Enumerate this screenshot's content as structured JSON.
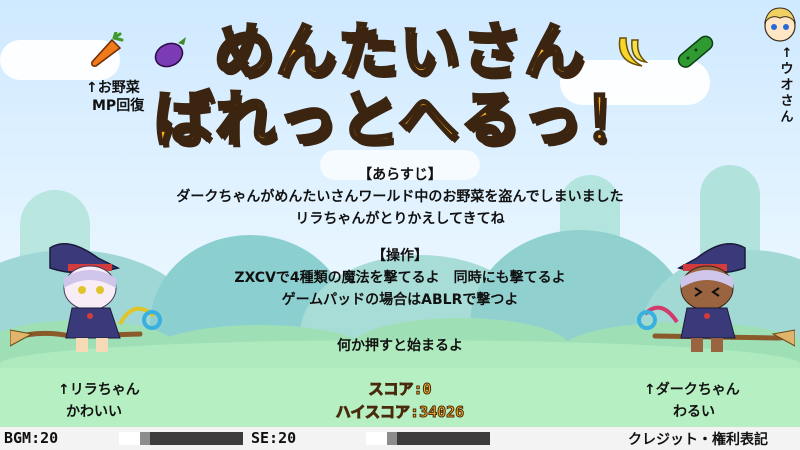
{
  "title": {
    "line1": "めんたいさん",
    "line2": "ばれっとへるっ！"
  },
  "veg_hint": {
    "line1": "↑お野菜",
    "line2": "MP回復"
  },
  "right_hint": "↑ウオさん",
  "story": {
    "heading": "【あらすじ】",
    "line1": "ダークちゃんがめんたいさんワールド中のお野菜を盗んでしまいました",
    "line2": "リラちゃんがとりかえしてきてね"
  },
  "controls": {
    "heading": "【操作】",
    "line1": "ZXCVで4種類の魔法を撃てるよ　同時にも撃てるよ",
    "line2": "ゲームパッドの場合はABLRで撃つよ"
  },
  "prompt": "何か押すと始まるよ",
  "score": {
    "score_line": "スコア:0",
    "hiscore_line": "ハイスコア:34026"
  },
  "left_char": {
    "line1": "↑リラちゃん",
    "line2": "かわいい"
  },
  "right_char": {
    "line1": "↑ダークちゃん",
    "line2": "わるい"
  },
  "bottom_bar": {
    "bgm_label": "BGM:20",
    "bgm_level": 0.2,
    "se_label": "SE:20",
    "se_level": 0.2,
    "credits_label": "クレジット・権利表記"
  },
  "colors": {
    "title_fill": "#ffb21e",
    "title_outline": "#3b2410",
    "sky": "#cfe9ff",
    "grass": "#b6efc1"
  },
  "icons": [
    "carrot-icon",
    "eggplant-icon",
    "banana-icon",
    "cucumber-icon",
    "uo-san-icon",
    "lila-chan-sprite",
    "dark-chan-sprite"
  ]
}
